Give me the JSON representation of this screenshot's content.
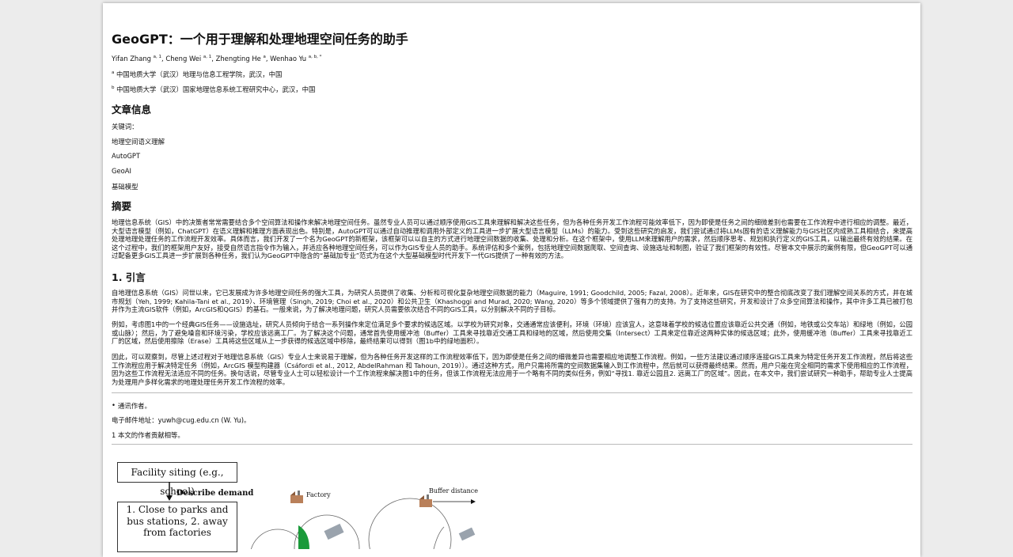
{
  "title": "GeoGPT：一个用于理解和处理地理空间任务的助手",
  "authors": [
    {
      "name": "Yifan Zhang",
      "sup": "a, 1"
    },
    {
      "name": "Cheng Wei",
      "sup": "a, 1"
    },
    {
      "name": "Zhengting He",
      "sup": "a"
    },
    {
      "name": "Wenhao Yu",
      "sup": "a, b, *"
    }
  ],
  "affiliations": [
    {
      "mark": "a",
      "text": "中国地质大学（武汉）地理与信息工程学院，武汉，中国"
    },
    {
      "mark": "b",
      "text": "中国地质大学（武汉）国家地理信息系统工程研究中心，武汉，中国"
    }
  ],
  "article_info": {
    "heading": "文章信息",
    "keywords_label": "关键词：",
    "keywords": [
      "地理空间语义理解",
      "AutoGPT",
      "GeoAI",
      "基础模型"
    ]
  },
  "abstract": {
    "heading": "摘要",
    "text": "地理信息系统（GIS）中的决策者常常需要结合多个空间算法和操作来解决地理空间任务。虽然专业人员可以通过顺序使用GIS工具来理解和解决这些任务，但为各种任务开发工作流程可能效率低下，因为即使是任务之间的细微差别也需要在工作流程中进行相应的调整。最近，大型语言模型（例如，ChatGPT）在语义理解和推理方面表现出色。特别是，AutoGPT可以通过自动推理和调用外部定义的工具进一步扩展大型语言模型（LLMs）的能力。受到这些研究的启发，我们尝试通过将LLMs固有的语义理解能力与GIS社区内成熟工具相结合，来提高处理地理处理任务的工作流程开发效率。具体而言，我们开发了一个名为GeoGPT的新框架，该框架可以以自主的方式进行地理空间数据的收集、处理和分析。在这个框架中，使用LLM来理解用户的需求，然后顺序思考、规划和执行定义的GIS工具，以输出最终有效的结果。在这个过程中，我们的框架用户友好，接受自然语言指令作为输入，并适应各种地理空间任务，可以作为GIS专业人员的助手。系统评估和多个案例，包括地理空间数据爬取、空间查询、设施选址和制图，验证了我们框架的有效性。尽管本文中展示的案例有限，但GeoGPT可以通过配备更多GIS工具进一步扩展到各种任务，我们认为GeoGPT中隐含的“基础加专业”范式为在这个大型基础模型时代开发下一代GIS提供了一种有效的方法。"
  },
  "intro": {
    "heading": "1. 引言",
    "paragraphs": [
      "自地理信息系统（GIS）问世以来，它已发展成为许多地理空间任务的强大工具，为研究人员提供了收集、分析和可视化复杂地理空间数据的能力（Maguire, 1991; Goodchild, 2005; Fazal, 2008）。近年来，GIS在研究中的整合彻底改变了我们理解空间关系的方式，并在城市规划（Yeh, 1999; Kahila-Tani et al., 2019）、环境管理（Singh, 2019; Choi et al., 2020）和公共卫生（Khashoggi and Murad, 2020; Wang, 2020）等多个领域提供了强有力的支持。为了支持这些研究，开发和设计了众多空间算法和操作，其中许多工具已被打包并作为主流GIS软件（例如，ArcGIS和QGIS）的基石。一般来说，为了解决地理问题，研究人员需要依次结合不同的GIS工具，以分别解决不同的子目标。",
      "例如，考虑图1中的一个经典GIS任务——设施选址，研究人员倾向于结合一系列操作来定位满足多个要求的候选区域。以学校为研究对象，交通通常应该便利，环境（环境）应该宜人，这意味着学校的候选位置应该靠近公共交通（例如，地铁或公交车站）和绿地（例如，公园或山脉）；然后，为了避免噪音和环境污染，学校应该远离工厂。为了解决这个问题，通常首先使用缓冲池（Buffer）工具来寻找靠近交通工具和绿地的区域，然后使用交集（Intersect）工具来定位靠近这两种实体的候选区域；此外，使用缓冲池（Buffer）工具来寻找靠近工厂的区域，然后使用擦除（Erase）工具将这些区域从上一步获得的候选区域中移除，最终结果可以得到（图1b中的绿地面积）。",
      "因此，可以观察到，尽管上述过程对于地理信息系统（GIS）专业人士来说易于理解，但为各种任务开发这样的工作流程效率低下，因为即使是任务之间的细微差异也需要相应地调整工作流程。例如，一些方法建议通过顺序连接GIS工具来为特定任务开发工作流程，然后将这些工作流程应用于解决特定任务（例如，ArcGIS 模型构建器（Csáfordi et al., 2012, AbdelRahman 和 Tahoun, 2019））。通过这种方式，用户只需将所需的空间数据集输入到工作流程中，然后就可以获得最终结果。然而，用户只能在完全相同的需求下使用相应的工作流程，因为这些工作流程无法适应不同的任务。换句话说，尽管专业人士可以轻松设计一个工作流程来解决图1中的任务，但该工作流程无法应用于一个略有不同的类似任务，例如“寻找1. 靠近公园且2. 远离工厂的区域”。因此，在本文中，我们尝试研究一种助手，帮助专业人士提高为处理用户多样化需求的地理处理任务开发工作流程的效率。"
    ]
  },
  "footnotes": {
    "corresponding": "通讯作者。",
    "email": "电子邮件地址：yuwh@cug.edu.cn (W. Yu)。",
    "contribution": "1 本文的作者贡献相等。"
  },
  "figure": {
    "box1": "Facility siting (e.g., school)",
    "describe": "Describe demand",
    "box2": "1. Close to parks and bus stations, 2. away from factories",
    "factory_label": "Factory",
    "buffer_label": "Buffer distance",
    "colors": {
      "green": "#1a9a3a",
      "gray": "#9aa3ad",
      "factory": "#b9805a"
    }
  }
}
